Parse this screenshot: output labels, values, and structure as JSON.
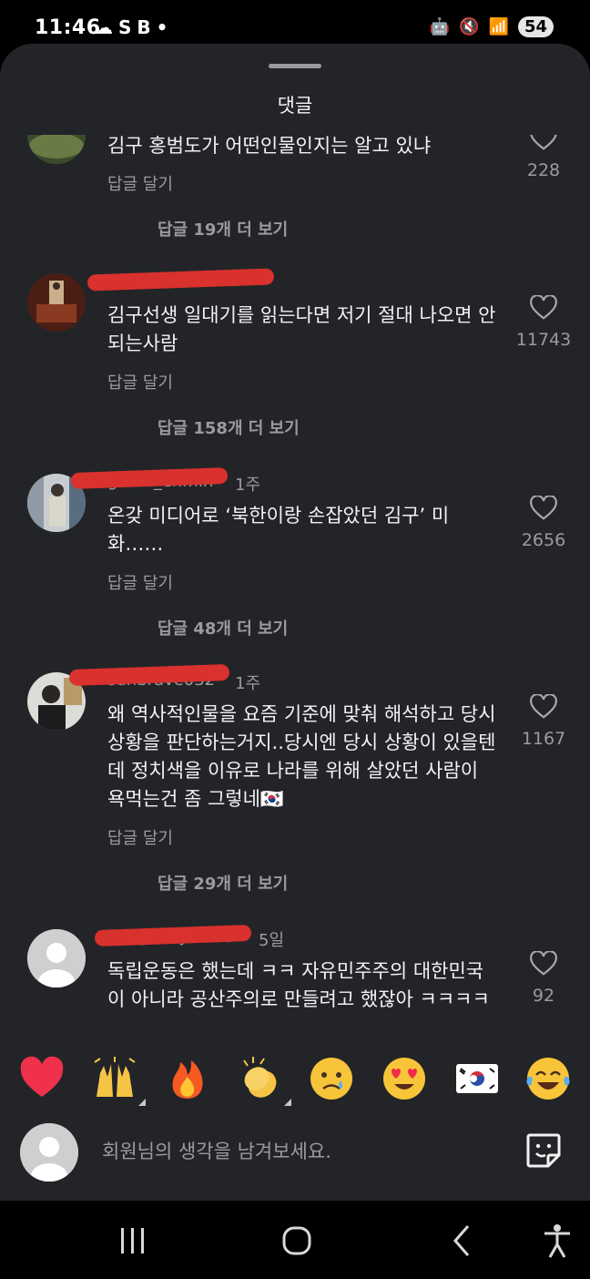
{
  "status_bar": {
    "time": "11:46",
    "left_icons": [
      "cloud-icon",
      "S",
      "B"
    ],
    "battery": "54"
  },
  "sheet": {
    "title": "댓글"
  },
  "comments": [
    {
      "username": "",
      "time_ago": "",
      "text": "김구 홍범도가 어떤인물인지는 알고 있냐",
      "reply_label": "답글 달기",
      "likes": "228",
      "more_replies": "답글 19개 더 보기"
    },
    {
      "username": "",
      "time_ago": "",
      "text": "김구선생 일대기를 읽는다면 저기 절대 나오면 안되는사람",
      "reply_label": "답글 달기",
      "likes": "11743",
      "more_replies": "답글 158개 더 보기"
    },
    {
      "username": "grace_enmin",
      "time_ago": "1주",
      "text": "온갖 미디어로 ‘북한이랑 손잡았던 김구’ 미화……",
      "reply_label": "답글 달기",
      "likes": "2656",
      "more_replies": "답글 48개 더 보기"
    },
    {
      "username": "sunbrave032",
      "time_ago": "1주",
      "text": "왜 역사적인물을 요즘 기준에 맞춰 해석하고 당시 상황을 판단하는거지..당시엔 당시 상황이 있을텐데 정치색을 이유로 나라를 위해 살았던 사람이 욕먹는건 좀 그렇네🇰🇷",
      "reply_label": "답글 달기",
      "likes": "1167",
      "more_replies": "답글 29개 더 보기"
    },
    {
      "username": "yungeonyeol89",
      "time_ago": "5일",
      "text": "독립운동은 했는데 ㅋㅋ 자유민주주의 대한민국이 아니라 공산주의로 만들려고 했잖아 ㅋㅋㅋㅋ",
      "reply_label": "",
      "likes": "92",
      "more_replies": ""
    }
  ],
  "emoji_bar": [
    "heart-emoji",
    "raising-hands-emoji",
    "fire-emoji",
    "clapping-hands-emoji",
    "crying-face-emoji",
    "heart-eyes-emoji",
    "korea-flag-emoji",
    "tears-of-joy-emoji"
  ],
  "input": {
    "placeholder": "회원님의 생각을 남겨보세요."
  },
  "colors": {
    "sheet_bg": "#232428",
    "redaction": "#d9312d",
    "muted_text": "#9b9b9f"
  }
}
